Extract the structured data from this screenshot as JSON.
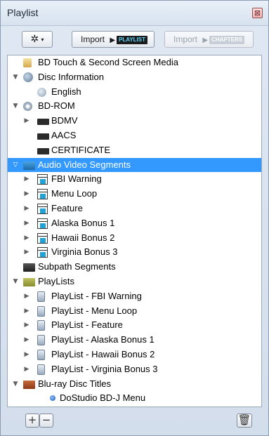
{
  "window": {
    "title": "Playlist",
    "close_label": "⊠"
  },
  "toolbar": {
    "gear_glyph": "✲",
    "import_playlist": {
      "label": "Import",
      "tag": "PLAYLIST"
    },
    "import_chapters": {
      "label": "Import",
      "tag": "CHAPTERS"
    }
  },
  "tree": {
    "selected_row": "Audio Video Segments",
    "rows": [
      {
        "label": "BD Touch & Second Screen Media",
        "icon": "touch-media-icon",
        "level": 0,
        "expander": ""
      },
      {
        "label": "Disc Information",
        "icon": "disc-info-icon",
        "level": 0,
        "expander": "▼"
      },
      {
        "label": "English",
        "icon": "language-disc-icon",
        "level": 1,
        "expander": ""
      },
      {
        "label": "BD-ROM",
        "icon": "disc-icon",
        "level": 0,
        "expander": "▼"
      },
      {
        "label": "BDMV",
        "icon": "folder-icon",
        "level": 1,
        "expander": "▶"
      },
      {
        "label": "AACS",
        "icon": "folder-icon",
        "level": 1,
        "expander": ""
      },
      {
        "label": "CERTIFICATE",
        "icon": "folder-icon",
        "level": 1,
        "expander": ""
      },
      {
        "label": "Audio Video Segments",
        "icon": "folder-blue-icon",
        "level": 0,
        "expander": "▽"
      },
      {
        "label": "FBI Warning",
        "icon": "video-clip-icon",
        "level": 1,
        "expander": "▶"
      },
      {
        "label": "Menu Loop",
        "icon": "video-clip-icon",
        "level": 1,
        "expander": "▶"
      },
      {
        "label": "Feature",
        "icon": "video-clip-icon",
        "level": 1,
        "expander": "▶"
      },
      {
        "label": "Alaska Bonus 1",
        "icon": "video-clip-icon",
        "level": 1,
        "expander": "▶"
      },
      {
        "label": "Hawaii Bonus 2",
        "icon": "video-clip-icon",
        "level": 1,
        "expander": "▶"
      },
      {
        "label": "Virginia Bonus 3",
        "icon": "video-clip-icon",
        "level": 1,
        "expander": "▶"
      },
      {
        "label": "Subpath Segments",
        "icon": "folder-dark-icon",
        "level": 0,
        "expander": ""
      },
      {
        "label": "PlayLists",
        "icon": "folder-olive-icon",
        "level": 0,
        "expander": "▼"
      },
      {
        "label": "PlayList - FBI Warning",
        "icon": "playlist-icon",
        "level": 1,
        "expander": "▶"
      },
      {
        "label": "PlayList - Menu Loop",
        "icon": "playlist-icon",
        "level": 1,
        "expander": "▶"
      },
      {
        "label": "PlayList - Feature",
        "icon": "playlist-icon",
        "level": 1,
        "expander": "▶"
      },
      {
        "label": "PlayList - Alaska Bonus 1",
        "icon": "playlist-icon",
        "level": 1,
        "expander": "▶"
      },
      {
        "label": "PlayList - Hawaii Bonus 2",
        "icon": "playlist-icon",
        "level": 1,
        "expander": "▶"
      },
      {
        "label": "PlayList - Virginia Bonus 3",
        "icon": "playlist-icon",
        "level": 1,
        "expander": "▶"
      },
      {
        "label": "Blu-ray Disc Titles",
        "icon": "folder-red-icon",
        "level": 0,
        "expander": "▼"
      },
      {
        "label": "DoStudio BD-J Menu",
        "icon": "title-dot-icon",
        "level": 2,
        "expander": ""
      }
    ]
  },
  "bottom": {
    "add_label": "+",
    "remove_label": "−",
    "trash_label": "🗑"
  },
  "colors": {
    "selection": "#3399ff",
    "panel_bg": "#d3deec",
    "tree_bg": "#ffffff"
  }
}
